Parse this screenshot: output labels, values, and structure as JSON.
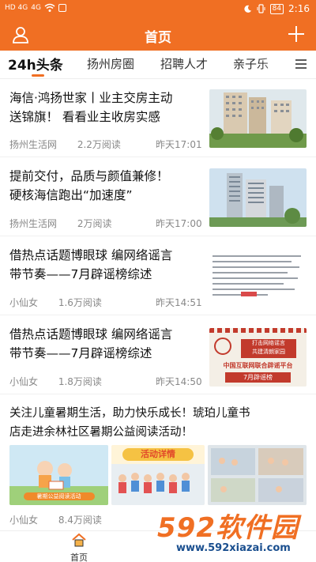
{
  "status_bar": {
    "signal1": "HD 4G",
    "signal2": "4G",
    "battery": "84",
    "time": "2:16"
  },
  "header": {
    "title": "首页"
  },
  "tabs": [
    {
      "label": "24h头条",
      "active": true
    },
    {
      "label": "扬州房圈"
    },
    {
      "label": "招聘人才"
    },
    {
      "label": "亲子乐"
    }
  ],
  "feed": [
    {
      "title_line1": "海信·鸿扬世家丨业主交房主动",
      "title_line2": "送锦旗！ 看看业主收房实感",
      "source": "扬州生活网",
      "reads": "2.2万阅读",
      "time": "昨天17:01",
      "thumb": "building-photo"
    },
    {
      "title_line1": "提前交付，品质与颜值兼修！",
      "title_line2": "硬核海信跑出“加速度”",
      "source": "扬州生活网",
      "reads": "2万阅读",
      "time": "昨天17:00",
      "thumb": "tower-photo"
    },
    {
      "title_line1": "借热点话题博眼球 编网络谣言",
      "title_line2": "带节奏——7月辟谣榜综述",
      "source": "小仙女",
      "reads": "1.6万阅读",
      "time": "昨天14:51",
      "thumb": "document-photo"
    },
    {
      "title_line1": "借热点话题博眼球 编网络谣言",
      "title_line2": "带节奏——7月辟谣榜综述",
      "source": "小仙女",
      "reads": "1.8万阅读",
      "time": "昨天14:50",
      "thumb": "rumor-poster",
      "poster_text": {
        "top": "打击网络谣言",
        "sub": "共建清朗家园",
        "main": "中国互联网联合辟谣平台",
        "month": "7月辟谣榜"
      }
    },
    {
      "title_line1": "关注儿童暑期生活，助力快乐成长！琥珀儿童书",
      "title_line2": "店走进余林社区暑期公益阅读活动！",
      "source": "小仙女",
      "reads": "8.4万阅读",
      "images": [
        "暑期公益阅读活动",
        "活动详情",
        "活动照片"
      ]
    }
  ],
  "bottom_nav": {
    "home_label": "首页"
  },
  "watermark": {
    "brand": "592软件园",
    "url": "www.592xiazai.com"
  },
  "colors": {
    "accent": "#f06f23"
  }
}
